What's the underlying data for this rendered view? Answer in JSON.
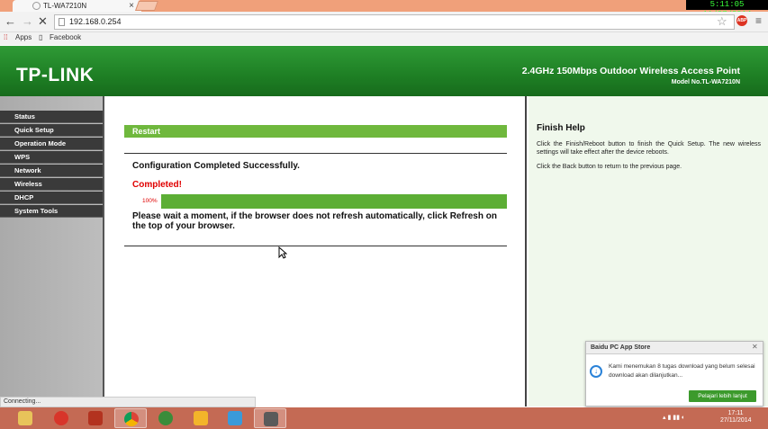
{
  "browser": {
    "tab_title": "TL-WA7210N",
    "clock": "5:11:05 11/27/2014",
    "url": "192.168.0.254",
    "bookmarks": [
      "Apps",
      "Facebook"
    ]
  },
  "banner": {
    "logo": "TP-LINK",
    "product": "2.4GHz 150Mbps Outdoor Wireless Access Point",
    "model": "Model No.TL-WA7210N"
  },
  "sidebar": {
    "items": [
      "Status",
      "Quick Setup",
      "Operation Mode",
      "WPS",
      "Network",
      "Wireless",
      "DHCP",
      "System Tools"
    ]
  },
  "main": {
    "section_title": "Restart",
    "config_message": "Configuration Completed Successfully.",
    "completed": "Completed!",
    "progress_label": "100%",
    "progress_value": 100,
    "wait_message": "Please wait a moment, if the browser does not refresh automatically, click Refresh on the top of your browser."
  },
  "help": {
    "title": "Finish Help",
    "p1": "Click the Finish/Reboot button to finish the Quick Setup. The new wireless settings will take effect after the device reboots.",
    "p2": "Click the Back button to return to the previous page."
  },
  "popup": {
    "title": "Baidu PC App Store",
    "message": "Kami menemukan 8 tugas download yang belum selesai download akan dilanjutkan...",
    "button": "Pelajari lebih lanjut"
  },
  "status_text": "Connecting...",
  "taskbar": {
    "time": "17:11",
    "date": "27/11/2014"
  },
  "colors": {
    "brand_green": "#1e7f24",
    "section_green": "#6fb83d",
    "alert_red": "#e00000"
  }
}
